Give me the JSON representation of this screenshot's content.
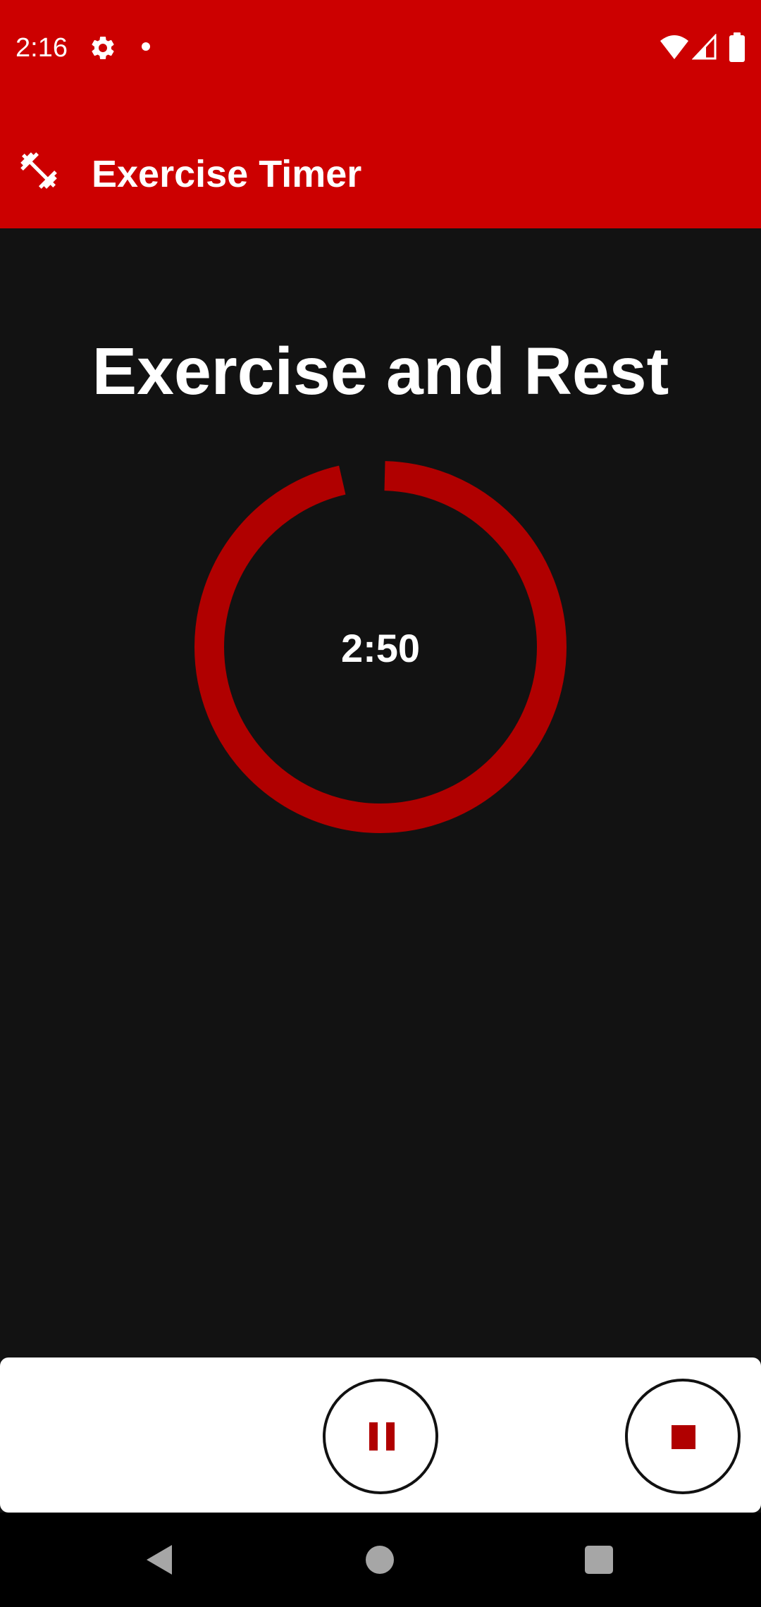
{
  "status_bar": {
    "time": "2:16",
    "icons": [
      "gear-icon",
      "notification-dot-icon",
      "wifi-icon",
      "signal-icon",
      "battery-icon"
    ]
  },
  "app_bar": {
    "title": "Exercise Timer",
    "icon": "dumbbell-icon",
    "background_color": "#cc0000"
  },
  "main": {
    "heading": "Exercise and Rest",
    "timer": {
      "display": "2:50",
      "progress_fraction": 0.96,
      "ring_color": "#b00000"
    }
  },
  "controls": {
    "pause_icon": "pause-icon",
    "stop_icon": "stop-icon",
    "icon_color": "#b00000"
  },
  "nav_bar": {
    "icons": [
      "back-icon",
      "home-icon",
      "recents-icon"
    ]
  }
}
